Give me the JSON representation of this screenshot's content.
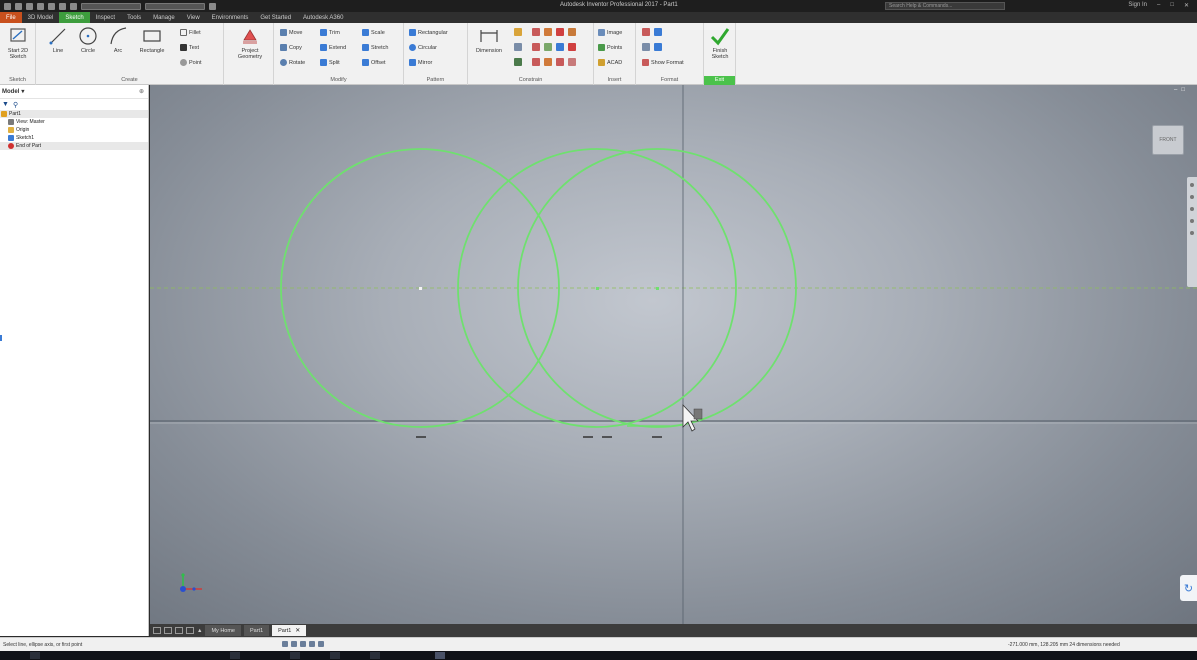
{
  "app": {
    "title": "Autodesk Inventor Professional 2017 - Part1",
    "search_placeholder": "Search Help & Commands...",
    "sign_in": "Sign In"
  },
  "menu": {
    "tabs": [
      "File",
      "3D Model",
      "Sketch",
      "Inspect",
      "Tools",
      "Manage",
      "View",
      "Environments",
      "Get Started",
      "Autodesk A360"
    ],
    "active": "Sketch"
  },
  "ribbon": {
    "sketch_panel": {
      "label": "Sketch",
      "start_2d_sketch": "Start 2D Sketch"
    },
    "create_panel": {
      "label": "Create",
      "line": "Line",
      "circle": "Circle",
      "arc": "Arc",
      "rectangle": "Rectangle",
      "fillet": "Fillet",
      "text": "Text",
      "point": "Point"
    },
    "project_geometry": "Project Geometry",
    "modify_panel": {
      "label": "Modify",
      "move": "Move",
      "copy": "Copy",
      "rotate": "Rotate",
      "trim": "Trim",
      "extend": "Extend",
      "split": "Split",
      "scale": "Scale",
      "stretch": "Stretch",
      "offset": "Offset"
    },
    "pattern_panel": {
      "label": "Pattern",
      "rectangular": "Rectangular",
      "circular": "Circular",
      "mirror": "Mirror"
    },
    "constrain_panel": {
      "label": "Constrain",
      "dimension": "Dimension"
    },
    "insert_panel": {
      "label": "Insert",
      "image": "Image",
      "points": "Points",
      "acad": "ACAD"
    },
    "format_panel": {
      "label": "Format",
      "show_format": "Show Format"
    },
    "exit_panel": {
      "label": "Exit",
      "finish_sketch": "Finish Sketch"
    }
  },
  "browser": {
    "header": "Model",
    "tree": [
      {
        "label": "Part1",
        "color": "#e0a020"
      },
      {
        "label": "View: Master",
        "color": "#7a7a7a"
      },
      {
        "label": "Origin",
        "color": "#e0b040"
      },
      {
        "label": "Sketch1",
        "color": "#3a7bd5"
      },
      {
        "label": "End of Part",
        "color": "#d03030"
      }
    ]
  },
  "viewcube": {
    "label": "FRONT"
  },
  "doc_tabs": {
    "home": "My Home",
    "part1": "Part1",
    "active": "Part1"
  },
  "status": {
    "message": "Select line, ellipse axis, or first point",
    "coords": "-271.000 mm, 128.205 mm  24 dimensions needed"
  },
  "colors": {
    "sketch_green": "#6fe06f",
    "active_tab": "#3d9d3d",
    "file_tab": "#c8501d"
  }
}
